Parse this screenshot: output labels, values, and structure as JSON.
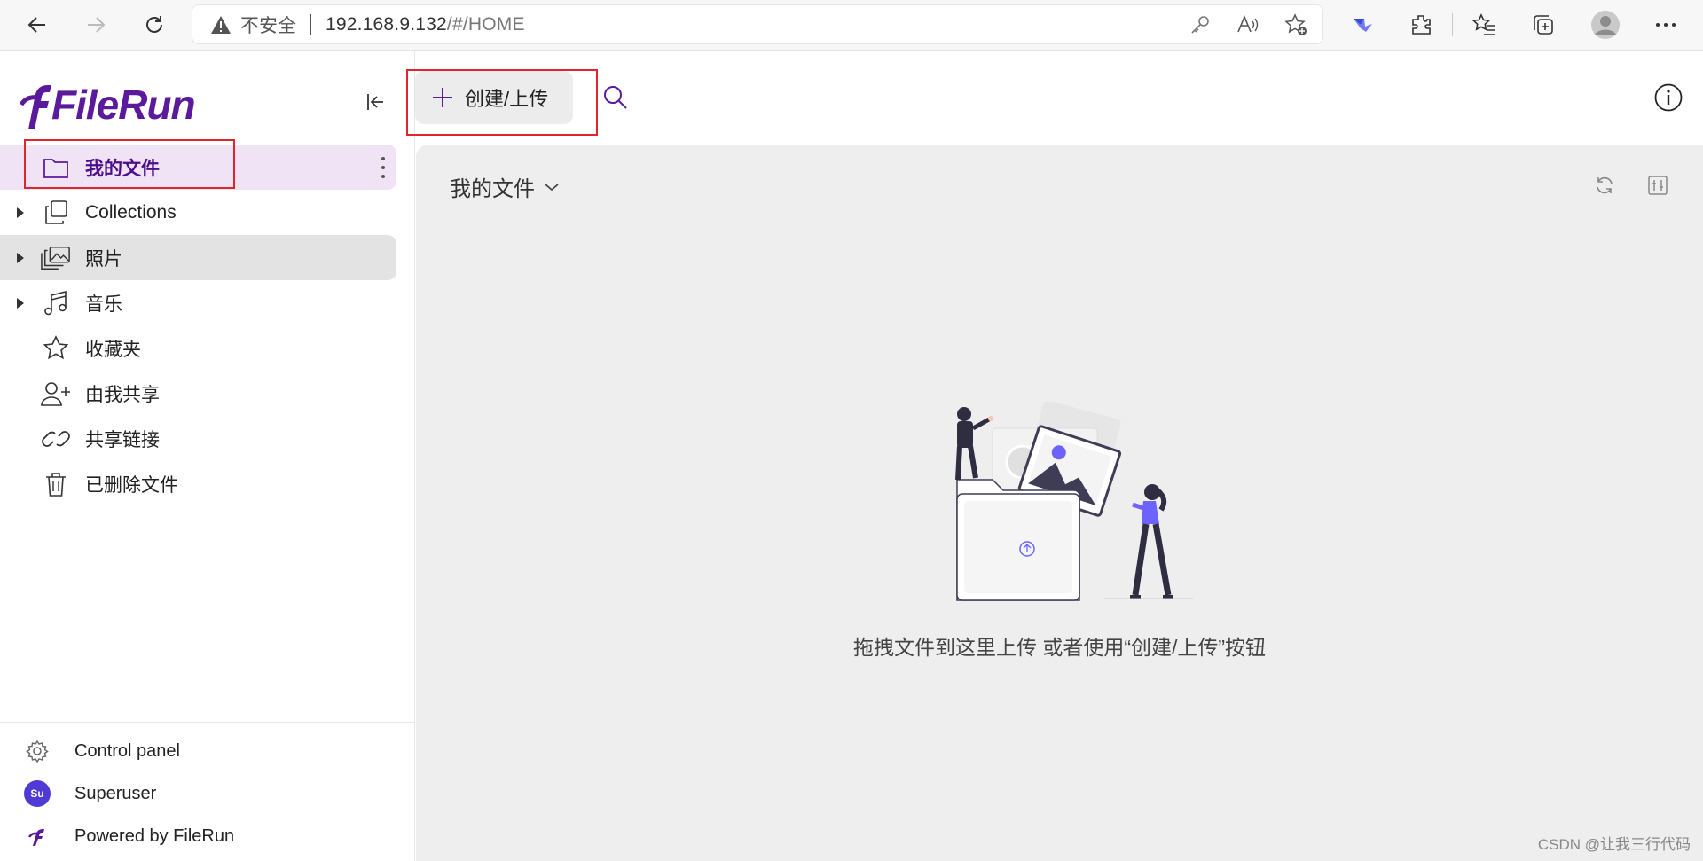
{
  "browser": {
    "insecure_label": "不安全",
    "url_host": "192.168.9.132",
    "url_path": "/#/HOME"
  },
  "app": {
    "logo_text": "FileRun",
    "brand_color": "#5b1a9c"
  },
  "sidebar": {
    "items": [
      {
        "label": "我的文件",
        "icon": "folder-icon",
        "expandable": false,
        "active": true
      },
      {
        "label": "Collections",
        "icon": "collections-icon",
        "expandable": true
      },
      {
        "label": "照片",
        "icon": "photos-icon",
        "expandable": true,
        "hovered": true
      },
      {
        "label": "音乐",
        "icon": "music-icon",
        "expandable": true
      },
      {
        "label": "收藏夹",
        "icon": "star-icon",
        "expandable": false
      },
      {
        "label": "由我共享",
        "icon": "user-share-icon",
        "expandable": false
      },
      {
        "label": "共享链接",
        "icon": "link-icon",
        "expandable": false
      },
      {
        "label": "已删除文件",
        "icon": "trash-icon",
        "expandable": false
      }
    ],
    "bottom": {
      "control_panel": "Control panel",
      "user": "Superuser",
      "user_initials": "Su",
      "powered_by": "Powered by FileRun"
    }
  },
  "toolbar": {
    "create_label": "创建/上传"
  },
  "main": {
    "title": "我的文件",
    "empty_message": "拖拽文件到这里上传 或者使用“创建/上传”按钮"
  },
  "watermark": "CSDN @让我三行代码"
}
